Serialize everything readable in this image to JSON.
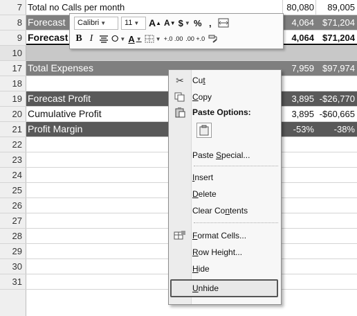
{
  "sheet": {
    "rows": [
      {
        "num": "7",
        "a": "Total no Calls per month",
        "d1": "80,080",
        "d2": "89,005"
      },
      {
        "num": "8",
        "a": "Forecast",
        "d1": "4,064",
        "d2": "$71,204"
      },
      {
        "num": "9",
        "a": "Forecast",
        "d1": "4,064",
        "d2": "$71,204"
      },
      {
        "num": "10",
        "a": "",
        "d1": "",
        "d2": ""
      },
      {
        "num": "17",
        "a": "Total Expenses",
        "d1": "7,959",
        "d2": "$97,974"
      },
      {
        "num": "18",
        "a": "",
        "d1": "",
        "d2": ""
      },
      {
        "num": "19",
        "a": "Forecast Profit",
        "d1": "3,895",
        "d2": "-$26,770"
      },
      {
        "num": "20",
        "a": "Cumulative Profit",
        "d1": "3,895",
        "d2": "-$60,665"
      },
      {
        "num": "21",
        "a": "Profit Margin",
        "d1": "-53%",
        "d2": "-38%"
      },
      {
        "num": "22",
        "a": "",
        "d1": "",
        "d2": ""
      },
      {
        "num": "23",
        "a": "",
        "d1": "",
        "d2": ""
      },
      {
        "num": "24",
        "a": "",
        "d1": "",
        "d2": ""
      },
      {
        "num": "25",
        "a": "",
        "d1": "",
        "d2": ""
      },
      {
        "num": "26",
        "a": "",
        "d1": "",
        "d2": ""
      },
      {
        "num": "27",
        "a": "",
        "d1": "",
        "d2": ""
      },
      {
        "num": "28",
        "a": "",
        "d1": "",
        "d2": ""
      },
      {
        "num": "29",
        "a": "",
        "d1": "",
        "d2": ""
      },
      {
        "num": "30",
        "a": "",
        "d1": "",
        "d2": ""
      },
      {
        "num": "31",
        "a": "",
        "d1": "",
        "d2": ""
      }
    ]
  },
  "minibar": {
    "font": "Calibri",
    "size": "11",
    "grow_font": "A",
    "shrink_font": "A",
    "currency": "$",
    "percent": "%",
    "comma": ",",
    "bold": "B",
    "italic": "I",
    "font_color": "A",
    "inc_decimal": "+.0 .00",
    "dec_decimal": ".00 +.0"
  },
  "menu": {
    "cut": "Cut",
    "copy": "Copy",
    "paste_options": "Paste Options:",
    "paste_special": "Paste Special...",
    "insert": "Insert",
    "delete": "Delete",
    "clear_contents": "Clear Contents",
    "format_cells": "Format Cells...",
    "row_height": "Row Height...",
    "hide": "Hide",
    "unhide": "Unhide"
  },
  "colors": {
    "header_gray": "#efefef",
    "row_dark": "#7f7f7f",
    "row_darker": "#595959",
    "highlight_border": "#555555"
  }
}
